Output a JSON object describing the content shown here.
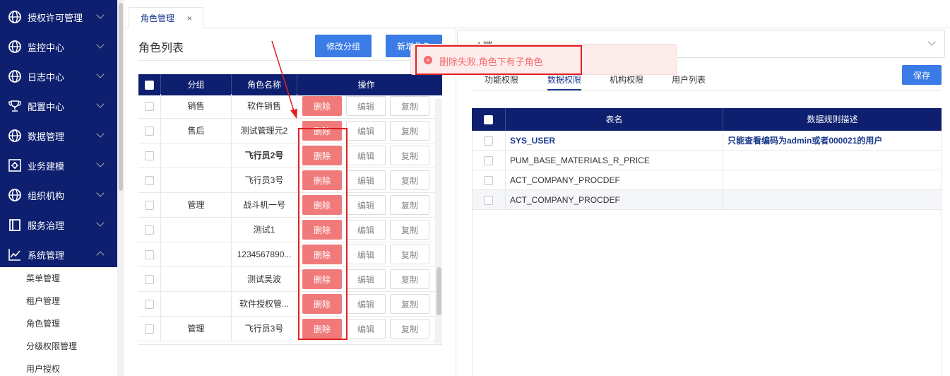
{
  "sidebar": {
    "items": [
      {
        "label": "授权许可管理",
        "icon": "globe-icon"
      },
      {
        "label": "监控中心",
        "icon": "globe-icon"
      },
      {
        "label": "日志中心",
        "icon": "globe-icon"
      },
      {
        "label": "配置中心",
        "icon": "trophy-icon"
      },
      {
        "label": "数据管理",
        "icon": "globe-icon"
      },
      {
        "label": "业务建模",
        "icon": "gear-box-icon"
      },
      {
        "label": "组织机构",
        "icon": "globe-icon"
      },
      {
        "label": "服务治理",
        "icon": "book-icon"
      },
      {
        "label": "系统管理",
        "icon": "chart-line-icon"
      }
    ],
    "subitems": [
      "菜单管理",
      "租户管理",
      "角色管理",
      "分级权限管理",
      "用户授权"
    ]
  },
  "tabs": [
    {
      "label": "角色管理",
      "close": "×"
    }
  ],
  "left": {
    "title": "角色列表",
    "btn_modify_group": "修改分组",
    "btn_new_role": "新增角色",
    "columns": [
      "分组",
      "角色名称",
      "操作"
    ],
    "delete_label": "删除",
    "edit_label": "编辑",
    "copy_label": "复制",
    "rows": [
      {
        "group": "销售",
        "name": "软件销售",
        "bold": false
      },
      {
        "group": "售后",
        "name": "测试管理元2",
        "bold": false
      },
      {
        "group": "",
        "name": "飞行员2号",
        "bold": true
      },
      {
        "group": "",
        "name": "飞行员3号",
        "bold": false
      },
      {
        "group": "管理",
        "name": "战斗机一号",
        "bold": false
      },
      {
        "group": "",
        "name": "测试1",
        "bold": false
      },
      {
        "group": "",
        "name": "1234567890...",
        "bold": false
      },
      {
        "group": "",
        "name": "测试吴波",
        "bold": false
      },
      {
        "group": "",
        "name": "软件授权管...",
        "bold": false
      },
      {
        "group": "管理",
        "name": "飞行员3号",
        "bold": false
      }
    ]
  },
  "right": {
    "select_value": "web端",
    "tabs": [
      "功能权限",
      "数据权限",
      "机构权限",
      "用户列表"
    ],
    "save_label": "保存",
    "columns": [
      "表名",
      "数据规则描述"
    ],
    "rows": [
      {
        "table": "SYS_USER",
        "desc": "只能查看编码为admin或者000021的用户",
        "bold": true
      },
      {
        "table": "PUM_BASE_MATERIALS_R_PRICE",
        "desc": "",
        "bold": false
      },
      {
        "table": "ACT_COMPANY_PROCDEF",
        "desc": "",
        "bold": false
      },
      {
        "table": "ACT_COMPANY_PROCDEF",
        "desc": "",
        "bold": false
      }
    ]
  },
  "toast": {
    "icon": "×",
    "message": "删除失败,角色下有子角色"
  }
}
